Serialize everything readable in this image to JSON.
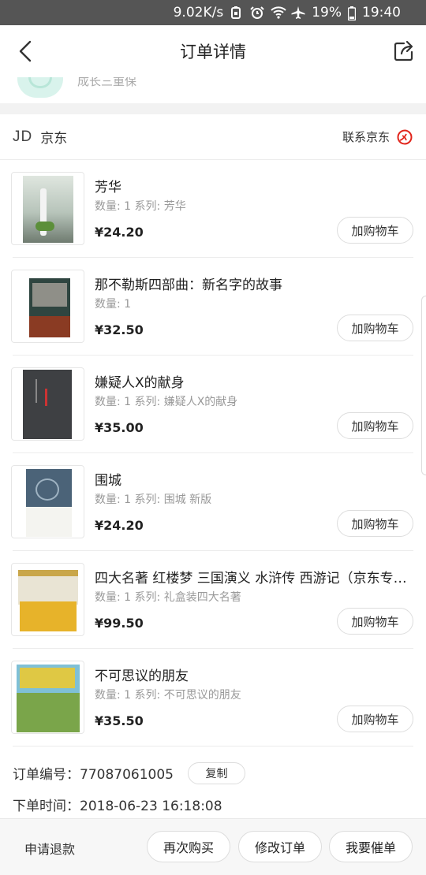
{
  "status_bar": {
    "speed": "9.02K/s",
    "battery": "19%",
    "time": "19:40"
  },
  "header": {
    "title": "订单详情"
  },
  "protection": {
    "text": "成长三重保"
  },
  "store": {
    "logo": "JD",
    "name": "京东",
    "contact_label": "联系京东"
  },
  "items": [
    {
      "title": "芳华",
      "meta": "数量: 1 系列: 芳华",
      "price": "¥24.20",
      "button": "加购物车"
    },
    {
      "title": "那不勒斯四部曲：新名字的故事",
      "meta": "数量: 1",
      "price": "¥32.50",
      "button": "加购物车"
    },
    {
      "title": "嫌疑人X的献身",
      "meta": "数量: 1 系列: 嫌疑人X的献身",
      "price": "¥35.00",
      "button": "加购物车"
    },
    {
      "title": "围城",
      "meta": "数量: 1 系列: 围城 新版",
      "price": "¥24.20",
      "button": "加购物车"
    },
    {
      "title": "四大名著 红楼梦 三国演义 水浒传 西游记（京东专…",
      "meta": "数量: 1 系列: 礼盒装四大名著",
      "price": "¥99.50",
      "button": "加购物车"
    },
    {
      "title": "不可思议的朋友",
      "meta": "数量: 1 系列: 不可思议的朋友",
      "price": "¥35.50",
      "button": "加购物车"
    }
  ],
  "order": {
    "number_label": "订单编号：77087061005",
    "copy_label": "复制",
    "time_label": "下单时间：2018-06-23 16:18:08"
  },
  "bottom": {
    "refund": "申请退款",
    "buy_again": "再次购买",
    "modify": "修改订单",
    "urge": "我要催单"
  },
  "colors": {
    "accent": "#e1251b",
    "separator": "#f2f2f2",
    "status_bar": "#555555"
  }
}
